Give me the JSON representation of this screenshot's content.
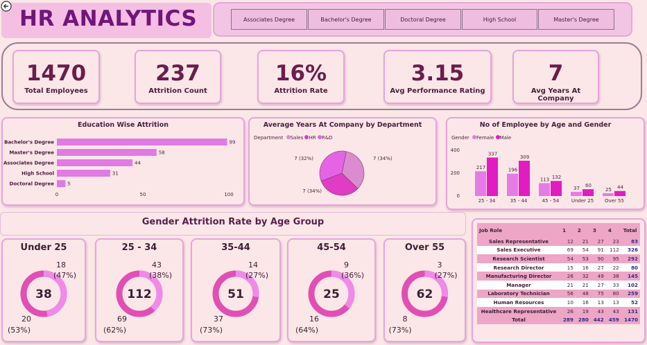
{
  "header": {
    "title": "HR ANALYTICS",
    "slicers": [
      "Associates Degree",
      "Bachelor's Degree",
      "Doctoral Degree",
      "High School",
      "Master's Degree"
    ]
  },
  "kpis": [
    {
      "value": "1470",
      "label": "Total Employees"
    },
    {
      "value": "237",
      "label": "Attrition Count"
    },
    {
      "value": "16%",
      "label": "Attrition Rate"
    },
    {
      "value": "3.15",
      "label": "Avg Performance Rating"
    },
    {
      "value": "7",
      "label": "Avg Years At Company"
    }
  ],
  "colors": {
    "accent": "#e27ae3",
    "female": "#e67be6",
    "male": "#e21cc0",
    "title": "#71157b"
  },
  "chart_data": [
    {
      "type": "bar",
      "orientation": "horizontal",
      "title": "Education Wise Attrition",
      "categories": [
        "Bachelor's Degree",
        "Master's Degree",
        "Associates Degree",
        "High School",
        "Doctoral Degree"
      ],
      "values": [
        99,
        58,
        44,
        31,
        5
      ],
      "xlim": [
        0,
        100
      ],
      "xticks": [
        "0",
        "50",
        "100"
      ]
    },
    {
      "type": "pie",
      "title": "Average Years At Company by Department",
      "legend_title": "Department",
      "categories": [
        "Sales",
        "HR",
        "R&D"
      ],
      "values": [
        7,
        7,
        7
      ],
      "labels": [
        "7 (34%)",
        "7 (32%)",
        "7 (34%)"
      ],
      "colors": [
        "#da8ccf",
        "#e03cc4",
        "#e464e5"
      ]
    },
    {
      "type": "bar",
      "title": "No of Employee by Age and Gender",
      "legend_title": "Gender",
      "ylabel": "",
      "categories": [
        "25 - 34",
        "35 - 44",
        "45 - 54",
        "Under 25",
        "Over 55"
      ],
      "series": [
        {
          "name": "Female",
          "values": [
            217,
            196,
            113,
            37,
            25
          ]
        },
        {
          "name": "Male",
          "values": [
            337,
            309,
            132,
            60,
            44
          ]
        }
      ],
      "ylim": [
        0,
        400
      ],
      "yticks": [
        "0",
        "200",
        "400"
      ]
    },
    {
      "type": "pie",
      "subtype": "donut",
      "title": "Gender Attrition Rate by Age Group",
      "groups": [
        {
          "name": "Under 25",
          "total": "38",
          "top_value": "18",
          "top_pct": "(47%)",
          "bottom_value": "20",
          "bottom_pct": "(53%)",
          "values": [
            18,
            20
          ]
        },
        {
          "name": "25 - 34",
          "total": "112",
          "top_value": "43",
          "top_pct": "(38%)",
          "bottom_value": "69",
          "bottom_pct": "(62%)",
          "values": [
            43,
            69
          ]
        },
        {
          "name": "35-44",
          "total": "51",
          "top_value": "14",
          "top_pct": "(27%)",
          "bottom_value": "37",
          "bottom_pct": "(73%)",
          "values": [
            14,
            37
          ]
        },
        {
          "name": "45-54",
          "total": "25",
          "top_value": "9",
          "top_pct": "(36%)",
          "bottom_value": "16",
          "bottom_pct": "(64%)",
          "values": [
            9,
            16
          ]
        },
        {
          "name": "Over 55",
          "total": "62",
          "top_value": "3",
          "top_pct": "(27%)",
          "bottom_value": "8",
          "bottom_pct": "(73%)",
          "values": [
            3,
            8
          ]
        }
      ]
    },
    {
      "type": "table",
      "columns": [
        "Job Role",
        "1",
        "2",
        "3",
        "4",
        "Total"
      ],
      "rows": [
        [
          "Sales Representative",
          "12",
          "21",
          "27",
          "23",
          "83"
        ],
        [
          "Sales Executive",
          "69",
          "54",
          "91",
          "112",
          "326"
        ],
        [
          "Research Scientist",
          "54",
          "53",
          "90",
          "95",
          "292"
        ],
        [
          "Research Director",
          "15",
          "16",
          "27",
          "22",
          "80"
        ],
        [
          "Manufacturing Director",
          "26",
          "32",
          "49",
          "38",
          "145"
        ],
        [
          "Manager",
          "21",
          "21",
          "27",
          "33",
          "102"
        ],
        [
          "Laboratory Technician",
          "56",
          "48",
          "75",
          "80",
          "259"
        ],
        [
          "Human Resources",
          "10",
          "16",
          "13",
          "13",
          "52"
        ],
        [
          "Healthcare Representative",
          "26",
          "19",
          "43",
          "43",
          "131"
        ]
      ],
      "total": [
        "Total",
        "289",
        "280",
        "442",
        "459",
        "1470"
      ]
    }
  ]
}
